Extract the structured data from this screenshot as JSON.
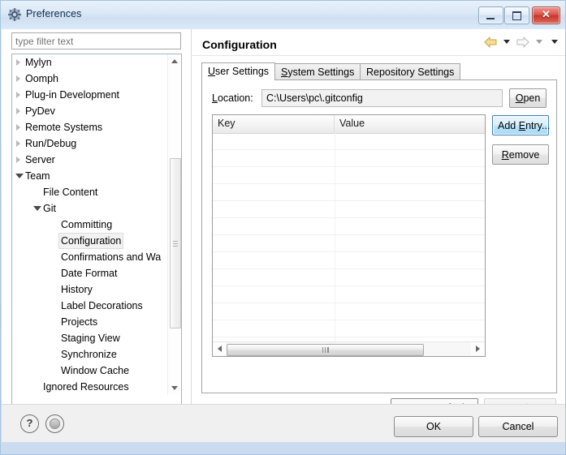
{
  "window": {
    "title": "Preferences",
    "icon": "preferences-gear-icon",
    "controls": {
      "minimize": "minimize-button",
      "maximize": "maximize-button",
      "close_glyph": "✕"
    }
  },
  "filter": {
    "placeholder": "type filter text",
    "value": ""
  },
  "tree": {
    "items": [
      {
        "label": "Mylyn",
        "indent": 0,
        "state": "collapsed",
        "selected": false
      },
      {
        "label": "Oomph",
        "indent": 0,
        "state": "collapsed",
        "selected": false
      },
      {
        "label": "Plug-in Development",
        "indent": 0,
        "state": "collapsed",
        "selected": false
      },
      {
        "label": "PyDev",
        "indent": 0,
        "state": "collapsed",
        "selected": false
      },
      {
        "label": "Remote Systems",
        "indent": 0,
        "state": "collapsed",
        "selected": false
      },
      {
        "label": "Run/Debug",
        "indent": 0,
        "state": "collapsed",
        "selected": false
      },
      {
        "label": "Server",
        "indent": 0,
        "state": "collapsed",
        "selected": false
      },
      {
        "label": "Team",
        "indent": 0,
        "state": "expanded",
        "selected": false
      },
      {
        "label": "File Content",
        "indent": 1,
        "state": "leaf",
        "selected": false
      },
      {
        "label": "Git",
        "indent": 1,
        "state": "expanded",
        "selected": false
      },
      {
        "label": "Committing",
        "indent": 2,
        "state": "leaf",
        "selected": false
      },
      {
        "label": "Configuration",
        "indent": 2,
        "state": "leaf",
        "selected": true
      },
      {
        "label": "Confirmations and Wa",
        "indent": 2,
        "state": "leaf",
        "selected": false
      },
      {
        "label": "Date Format",
        "indent": 2,
        "state": "leaf",
        "selected": false
      },
      {
        "label": "History",
        "indent": 2,
        "state": "leaf",
        "selected": false
      },
      {
        "label": "Label Decorations",
        "indent": 2,
        "state": "leaf",
        "selected": false
      },
      {
        "label": "Projects",
        "indent": 2,
        "state": "leaf",
        "selected": false
      },
      {
        "label": "Staging View",
        "indent": 2,
        "state": "leaf",
        "selected": false
      },
      {
        "label": "Synchronize",
        "indent": 2,
        "state": "leaf",
        "selected": false
      },
      {
        "label": "Window Cache",
        "indent": 2,
        "state": "leaf",
        "selected": false
      },
      {
        "label": "Ignored Resources",
        "indent": 1,
        "state": "leaf",
        "selected": false
      }
    ]
  },
  "page": {
    "title": "Configuration",
    "nav": {
      "back_icon": "back-arrow-icon",
      "back_enabled": true,
      "forward_icon": "forward-arrow-icon",
      "forward_enabled": false,
      "menu_icon": "view-menu-icon"
    }
  },
  "tabs": [
    {
      "label": "User Settings",
      "mnemonic": "U",
      "active": true
    },
    {
      "label": "System Settings",
      "mnemonic": "S",
      "active": false
    },
    {
      "label": "Repository Settings",
      "mnemonic": "",
      "active": false
    }
  ],
  "location": {
    "label": "Location:",
    "label_mnemonic": "L",
    "value": "C:\\Users\\pc\\.gitconfig",
    "open_button": "Open",
    "open_mnemonic": "O"
  },
  "table": {
    "columns": [
      "Key",
      "Value"
    ],
    "rows": [],
    "empty_row_count": 13
  },
  "side_buttons": [
    {
      "label": "Add Entry...",
      "mnemonic": "E",
      "focused": true,
      "enabled": true
    },
    {
      "label": "Remove",
      "mnemonic": "R",
      "focused": false,
      "enabled": true
    }
  ],
  "page_buttons": [
    {
      "label": "Restore Defaults",
      "mnemonic": "D",
      "enabled": true
    },
    {
      "label": "Apply",
      "mnemonic": "A",
      "enabled": false
    }
  ],
  "footer": {
    "help_icon": "help-question-icon",
    "history_icon": "history-circle-icon",
    "ok": "OK",
    "cancel": "Cancel"
  },
  "colors": {
    "accent": "#3c7fb1",
    "focus_fill": "#bee6fd",
    "title_bg": "#dce9f7",
    "close_red": "#c7352b",
    "back_arrow": "#f2d17c",
    "disabled_text": "#a6a6a6"
  }
}
